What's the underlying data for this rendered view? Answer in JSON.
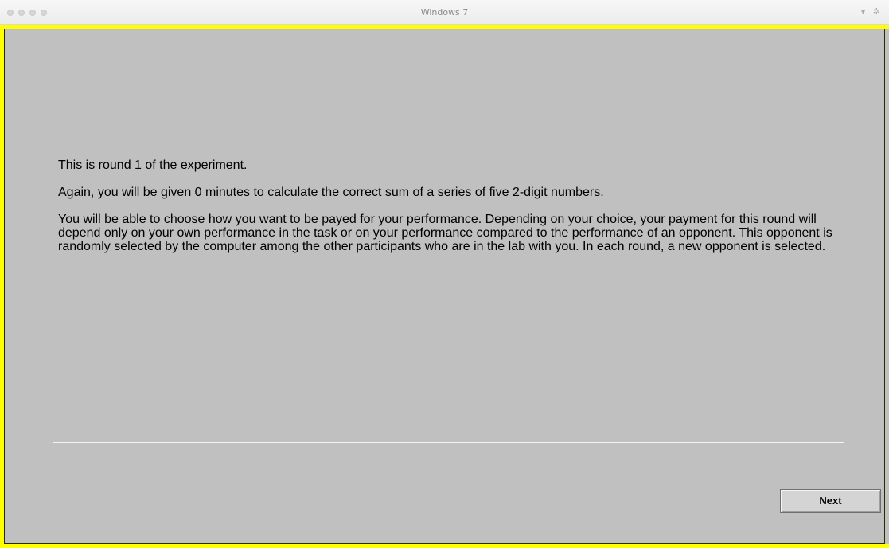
{
  "window": {
    "title": "Windows 7",
    "controls_icon": "▾ ✲"
  },
  "instructions": {
    "paragraph1": "This is round 1 of the experiment.",
    "paragraph2": "Again, you will be given 0 minutes to calculate the correct sum of a series of five 2-digit numbers.",
    "paragraph3": "You will be able to choose how you want to be payed for your performance. Depending on your choice, your payment for this round will depend only on your own performance in the task or on your performance compared to the performance of an opponent. This opponent is randomly selected by the computer among the other participants who are in the lab with you. In each round, a new opponent is selected."
  },
  "buttons": {
    "next_label": "Next"
  },
  "colors": {
    "frame_border": "#ffff00",
    "background": "#c0c0c0"
  }
}
